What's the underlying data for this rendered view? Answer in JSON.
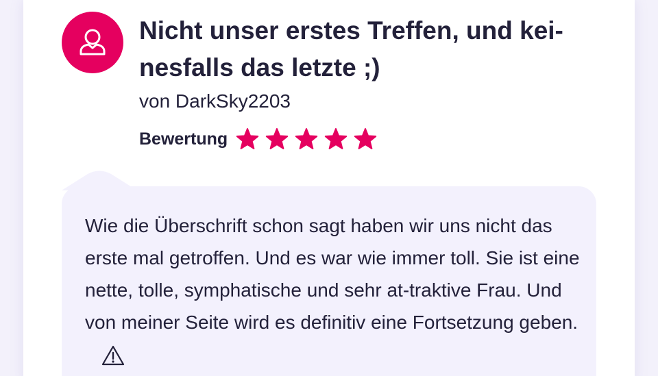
{
  "review": {
    "avatar_icon": "user-icon",
    "title": "Nicht unser erstes Treffen, und kei-nesfalls das letzte ;)",
    "author_line": "von DarkSky2203",
    "rating_label": "Bewertung",
    "rating_value": 5,
    "rating_max": 5,
    "text": "Wie die Überschrift schon sagt haben wir uns nicht das erste mal getroffen. Und es war wie immer toll. Sie ist eine nette, tolle, symphatische und sehr at-traktive Frau. Und von meiner Seite wird es definitiv eine Fortsetzung geben.",
    "report_icon": "warning-icon"
  },
  "colors": {
    "accent": "#e5005f",
    "text": "#23213a",
    "bubble": "#f3f1fd"
  }
}
